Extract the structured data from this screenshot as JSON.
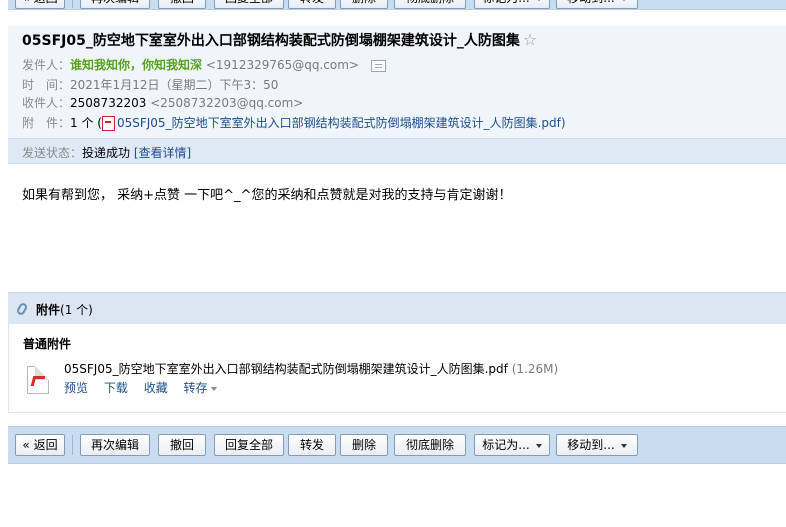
{
  "toolbar": {
    "back": "« 返回",
    "reedit": "再次编辑",
    "recall": "撤回",
    "reply_all": "回复全部",
    "forward": "转发",
    "delete": "删除",
    "delete_forever": "彻底删除",
    "mark_as": "标记为...",
    "move_to": "移动到..."
  },
  "mail": {
    "subject": "05SFJ05_防空地下室室外出入口部钢结构装配式防倒塌棚架建筑设计_人防图集",
    "star": "☆",
    "sender_label": "发件人：",
    "sender_name": "谁知我知你，你知我知深",
    "sender_email": "<1912329765@qq.com>",
    "time_label": "时　间：",
    "time_value": "2021年1月12日（星期二）下午3：50",
    "recipient_label": "收件人：",
    "recipient_name": "2508732203",
    "recipient_email": "<2508732203@qq.com>",
    "attach_label": "附　件：",
    "attach_count": "1 个 (",
    "attach_file": "05SFJ05_防空地下室室外出入口部钢结构装配式防倒塌棚架建筑设计_人防图集.pdf",
    "attach_close": ")",
    "status_label": "发送状态：",
    "status_value": "投递成功",
    "status_detail": "[查看详情]",
    "body": "如果有帮到您， 采纳+点赞 一下吧^_^您的采纳和点赞就是对我的支持与肯定谢谢！"
  },
  "attachments": {
    "title": "附件",
    "count": "(1 个)",
    "section": "普通附件",
    "file_name": "05SFJ05_防空地下室室外出入口部钢结构装配式防倒塌棚架建筑设计_人防图集.pdf",
    "file_size": "(1.26M)",
    "preview": "预览",
    "download": "下载",
    "collect": "收藏",
    "save_to": "转存"
  },
  "colors": {
    "toolbar_bg": "#c9dcf0",
    "header_bg": "#eff5fb",
    "link": "#1e4e8c",
    "sender_green": "#59a01f"
  }
}
